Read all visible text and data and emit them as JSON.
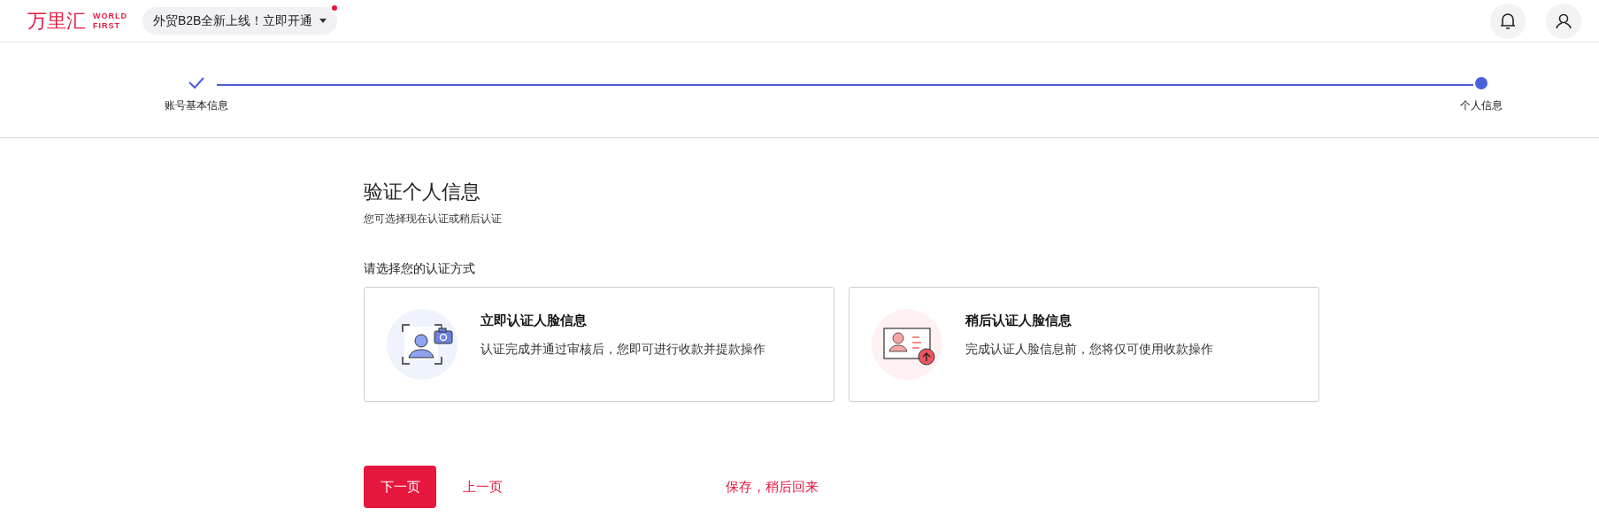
{
  "header": {
    "logo_text": "万里汇",
    "logo_sub_1": "WORLD",
    "logo_sub_2": "FIRST",
    "promo": {
      "label": "外贸B2B全新上线！立即开通",
      "unread": true
    }
  },
  "steps": [
    {
      "label": "账号基本信息",
      "completed": true
    },
    {
      "label": "个人信息",
      "completed": false
    }
  ],
  "title": "验证个人信息",
  "subtitle": "您可选择现在认证或稍后认证",
  "prompt": "请选择您的认证方式",
  "options": [
    {
      "kind": "now",
      "title": "立即认证人脸信息",
      "description": "认证完成并通过审核后，您即可进行收款并提款操作",
      "selected": false
    },
    {
      "kind": "later",
      "title": "稍后认证人脸信息",
      "description": "完成认证人脸信息前，您将仅可使用收款操作",
      "selected": false
    }
  ],
  "buttons": {
    "next": "下一页",
    "back": "上一页",
    "save": "保存，稍后回来"
  }
}
